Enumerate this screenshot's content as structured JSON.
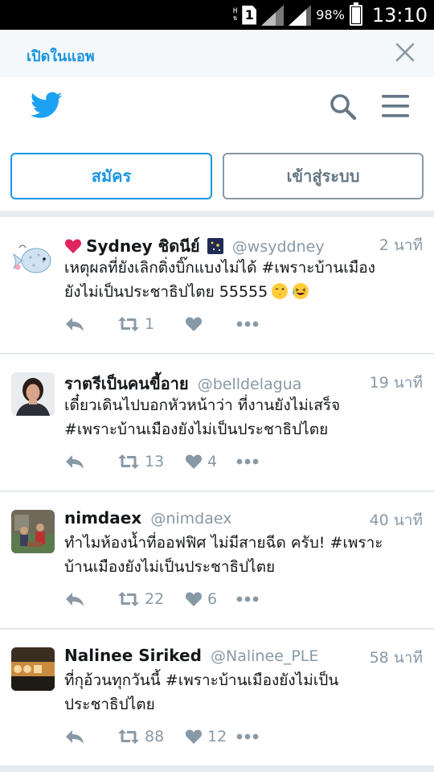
{
  "status_bar": {
    "net_h": "H",
    "net_arrows": "⇅",
    "sim": "1",
    "battery_pct": "98%",
    "battery_level": 0.98,
    "time": "13:10"
  },
  "banner": {
    "open_in_app": "เปิดในแอพ"
  },
  "header": {
    "logo": "twitter-bird-icon"
  },
  "auth": {
    "signup_label": "สมัคร",
    "login_label": "เข้าสู่ระบบ"
  },
  "colors": {
    "brand_blue": "#1b95e0",
    "muted": "#8899a6",
    "text": "#14171a",
    "background": "#e6ecf0"
  },
  "tweets": [
    {
      "name": "Sydney ชิดนีย์",
      "handle": "@wsyddney",
      "time": "2 นาที",
      "text": "เหตุผลที่ยังเลิกติ่งบิ๊กแบงไม่ได้  #เพราะบ้านเมือง\nยังไม่เป็นประชาธิปไตย  55555",
      "retweets": "1",
      "likes": ""
    },
    {
      "name": "ราตรีเป็นคนขี้อาย",
      "handle": "@belldelagua",
      "time": "19 นาที",
      "text": "เดี๋ยวเดินไปบอกหัวหน้าว่า ที่งานยังไม่เสร็จ\n#เพราะบ้านเมืองยังไม่เป็นประชาธิปไตย",
      "retweets": "13",
      "likes": "4"
    },
    {
      "name": "nimdaex",
      "handle": "@nimdaex",
      "time": "40 นาที",
      "text": "ทำไมห้องน้ำที่ออฟฟิศ ไม่มีสายฉีด ครับ!  #เพราะ\nบ้านเมืองยังไม่เป็นประชาธิปไตย",
      "retweets": "22",
      "likes": "6"
    },
    {
      "name": "Nalinee Siriked",
      "handle": "@Nalinee_PLE",
      "time": "58 นาที",
      "text": "ที่กุอ้วนทุกวันนี้ #เพราะบ้านเมืองยังไม่เป็น\nประชาธิปไตย",
      "retweets": "88",
      "likes": "12"
    }
  ]
}
